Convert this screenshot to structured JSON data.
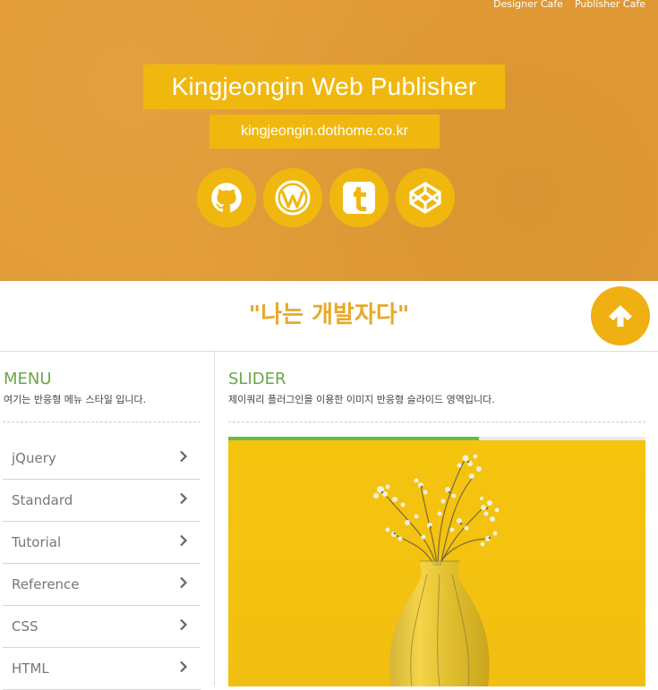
{
  "header": {
    "top_links": [
      "Designer Cafe",
      "Publisher Cafe"
    ],
    "title": "Kingjeongin Web Publisher",
    "url": "kingjeongin.dothome.co.kr",
    "social_icons": [
      "github-icon",
      "wordpress-icon",
      "tumblr-icon",
      "codepen-icon"
    ]
  },
  "quote": "\"나는 개발자다\"",
  "top_button_icon": "arrow-up-icon",
  "menu": {
    "title": "MENU",
    "description": "여기는 반응형 메뉴 스타일 입니다.",
    "items": [
      "jQuery",
      "Standard",
      "Tutorial",
      "Reference",
      "CSS",
      "HTML"
    ]
  },
  "slider": {
    "title": "SLIDER",
    "description": "제이쿼리 플러그인을 이용한 이미지 반응형 슬라이드 영역입니다.",
    "progress": 0.6,
    "image": "yellow-background-glass-vase-with-dried-flowers"
  },
  "colors": {
    "header_bg": "#e29b35",
    "accent_yellow": "#f0b80f",
    "quote_color": "#e8a92a",
    "section_title_green": "#6aa54a",
    "progress_green": "#6ab94a"
  }
}
